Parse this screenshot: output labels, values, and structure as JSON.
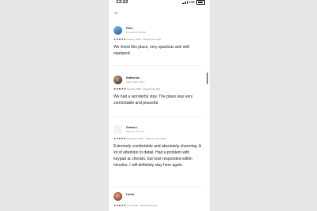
{
  "status_bar": {
    "time": "13:22",
    "network": "LTE"
  },
  "reviews": [
    {
      "name": "Felix",
      "subtitle": "12 years on Airbnb",
      "rating": "★★★★★",
      "date": "January 2025",
      "separator": "·",
      "stay": "Stayed one night",
      "text": "We loved this place, very spacious and well equipped."
    },
    {
      "name": "Katherine",
      "subtitle": "Idaho Falls, Idaho",
      "rating": "★★★★★",
      "date": "January 2025",
      "separator": "·",
      "stay": "Stayed with kids",
      "text": "We had a wonderful stay. The place was very comfortable and peaceful."
    },
    {
      "name": "Donna L",
      "subtitle": "Phoenix, Arizona",
      "rating": "★★★★★",
      "date": "December 2025",
      "separator": "·",
      "stay": "Stayed a few nights",
      "text": "Extremely comfortable and absolutely charming. A lot of attention to detail. Had a problem with keypad at checkin, but host responded within minutes. I will definitely stay here again."
    },
    {
      "name": "Laura",
      "subtitle": "",
      "rating": "★★★★★",
      "date": "June 2025",
      "separator": "·",
      "stay": "Stayed with kids",
      "text": ""
    }
  ],
  "colors": {
    "accent": "#222222",
    "muted": "#888888",
    "divider": "#eeeeee"
  }
}
